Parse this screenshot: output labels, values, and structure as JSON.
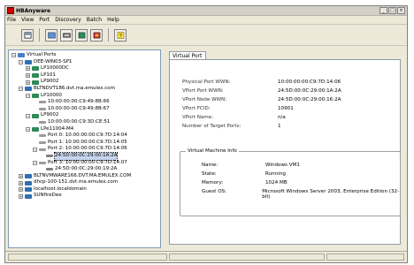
{
  "window": {
    "title": "HBAnyware"
  },
  "menu": [
    "File",
    "View",
    "Port",
    "Discovery",
    "Batch",
    "Help"
  ],
  "toolbar": {
    "buttons": [
      "view-hosts-icon",
      "view-fabric-icon",
      "local-hbas-icon",
      "hba-icon",
      "settings-icon",
      "help-icon"
    ]
  },
  "tree": {
    "items": [
      {
        "label": "Virtual Ports",
        "depth": 0,
        "expander": "-",
        "icon": "root"
      },
      {
        "label": "DEE-WIN03-SP1",
        "depth": 1,
        "expander": "-",
        "icon": "host"
      },
      {
        "label": "LP10000DC",
        "depth": 2,
        "expander": "+",
        "icon": "hba"
      },
      {
        "label": "LP101",
        "depth": 2,
        "expander": "+",
        "icon": "hba"
      },
      {
        "label": "LP9002",
        "depth": 2,
        "expander": "+",
        "icon": "hba"
      },
      {
        "label": "BLTNDVT186.dvt.ma.emulex.com",
        "depth": 1,
        "expander": "-",
        "icon": "host"
      },
      {
        "label": "LP10000",
        "depth": 2,
        "expander": "-",
        "icon": "hba"
      },
      {
        "label": "10:00:00:00:C9:49:8B:66",
        "depth": 3,
        "expander": "",
        "icon": "port"
      },
      {
        "label": "10:00:00:00:C9:49:8B:67",
        "depth": 3,
        "expander": "",
        "icon": "port"
      },
      {
        "label": "LP9002",
        "depth": 2,
        "expander": "-",
        "icon": "hba"
      },
      {
        "label": "10:00:00:00:C9:3D:CE:51",
        "depth": 3,
        "expander": "",
        "icon": "port"
      },
      {
        "label": "LPe11004-M4",
        "depth": 2,
        "expander": "-",
        "icon": "hba"
      },
      {
        "label": "Port 0: 10:00:00:00:C9:7D:14:04",
        "depth": 3,
        "expander": "",
        "icon": "port"
      },
      {
        "label": "Port 1: 10:00:00:00:C9:7D:14:05",
        "depth": 3,
        "expander": "",
        "icon": "port"
      },
      {
        "label": "Port 2: 10:00:00:00:C9:7D:14:06",
        "depth": 3,
        "expander": "-",
        "icon": "port"
      },
      {
        "label": "24:5D:00:0C:29:00:1A:2A",
        "depth": 4,
        "expander": "",
        "icon": "vport",
        "selected": true
      },
      {
        "label": "Port 3: 10:00:00:00:C9:7D:14:07",
        "depth": 3,
        "expander": "-",
        "icon": "port"
      },
      {
        "label": "24:5D:00:0C:29:00:19:2A",
        "depth": 4,
        "expander": "",
        "icon": "vport"
      },
      {
        "label": "BLTNVMWARE166.DVT.MA.EMULEX.COM",
        "depth": 1,
        "expander": "+",
        "icon": "host"
      },
      {
        "label": "dhcp-100-151.dvt.ma.emulex.com",
        "depth": 1,
        "expander": "+",
        "icon": "host"
      },
      {
        "label": "localhost.localdomain",
        "depth": 1,
        "expander": "+",
        "icon": "host"
      },
      {
        "label": "SUNfireDee",
        "depth": 1,
        "expander": "+",
        "icon": "host"
      }
    ]
  },
  "tab": {
    "label": "Virtual Port"
  },
  "properties": [
    {
      "label": "Physical Port WWN:",
      "value": "10:00:00:00:C9:7D:14:06"
    },
    {
      "label": "VPort Port WWN:",
      "value": "24:5D:00:0C:29:00:1A:2A"
    },
    {
      "label": "VPort Node WWN:",
      "value": "24:5D:00:0C:29:00:16:2A"
    },
    {
      "label": "VPort FCID:",
      "value": "10901"
    },
    {
      "label": "VPort Name:",
      "value": "n/a"
    },
    {
      "label": "Number of Target Ports:",
      "value": "1"
    }
  ],
  "vm_info": {
    "title": "Virtual Machine Info",
    "rows": [
      {
        "label": "Name:",
        "value": "Windows VM1"
      },
      {
        "label": "State:",
        "value": "Running"
      },
      {
        "label": "Memory:",
        "value": "1024 MB"
      },
      {
        "label": "Guest OS:",
        "value": "Microsoft Windows Server 2003, Enterprise Edition (32-bit)"
      }
    ]
  }
}
